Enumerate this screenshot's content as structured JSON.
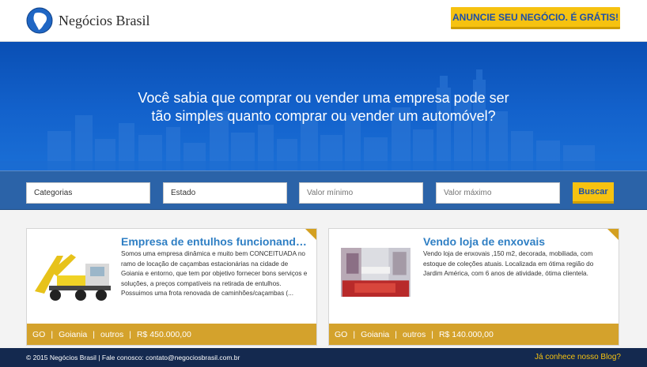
{
  "header": {
    "brand": "Negócios Brasil",
    "cta_label": "ANUNCIE SEU NEGÓCIO. É GRÁTIS!"
  },
  "hero": {
    "line1": "Você sabia que comprar ou vender uma empresa pode ser",
    "line2": "tão simples quanto comprar ou vender um automóvel?"
  },
  "search": {
    "category_label": "Categorias",
    "state_label": "Estado",
    "min_placeholder": "Valor mínimo",
    "max_placeholder": "Valor máximo",
    "submit_label": "Buscar"
  },
  "listings": [
    {
      "title": "Empresa de entulhos funcionand…",
      "description": "Somos uma empresa dinâmica e muito bem CONCEITUADA no ramo de locação de caçambas estacionárias na cidade de Goiania e entorno, que tem por objetivo fornecer bons serviços e soluções, a preços compatíveis na retirada de entulhos. Possuimos uma frota renovada de caminhões/caçambas (...",
      "state": "GO",
      "city": "Goiania",
      "category": "outros",
      "price": "R$ 450.000,00"
    },
    {
      "title": "Vendo loja de enxovais",
      "description": "Vendo loja de enxovais ,150 m2, decorada, mobiliada, com estoque de coleções atuais. Localizada em ótima região do Jardim América, com 6 anos de atividade, ótima clientela.",
      "state": "GO",
      "city": "Goiania",
      "category": "outros",
      "price": "R$ 140.000,00"
    }
  ],
  "footer": {
    "copyright": "© 2015 Negócios Brasil  | Fale conosco: contato@negociosbrasil.com.br",
    "blog_link": "Já conhece nosso Blog?"
  },
  "colors": {
    "accent_yellow": "#f6c210",
    "hero_blue": "#1362cc",
    "card_footer": "#d4a22c",
    "title_blue": "#2f7fc4",
    "bottom_bar": "#14294f"
  }
}
